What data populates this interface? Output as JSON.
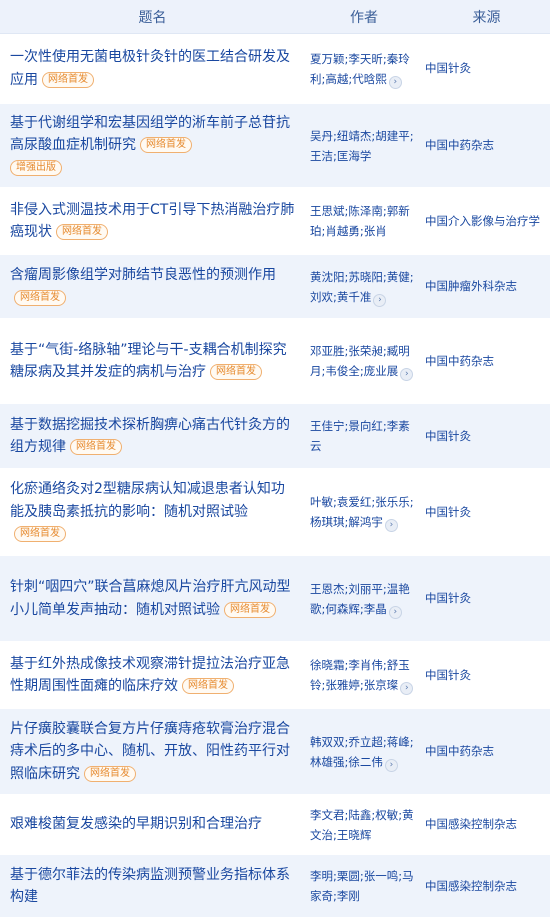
{
  "header": {
    "title": "题名",
    "author": "作者",
    "source": "来源"
  },
  "more_glyph": "›",
  "rows": [
    {
      "title": "一次性使用无菌电极针灸针的医工结合研发及应用",
      "tags": [
        "网络首发"
      ],
      "authors": "夏万颖;李天昕;秦玲利;高越;代晗熙",
      "more": true,
      "source": "中国针灸"
    },
    {
      "title": "基于代谢组学和宏基因组学的淅车前子总苷抗高尿酸血症机制研究",
      "tags": [
        "网络首发",
        "增强出版"
      ],
      "authors": "吴丹;纽靖杰;胡建平;王洁;匡海学",
      "more": false,
      "source": "中国中药杂志"
    },
    {
      "title": "非侵入式测温技术用于CT引导下热消融治疗肺癌现状",
      "tags": [
        "网络首发"
      ],
      "authors": "王思斌;陈泽南;郭新珀;肖越勇;张肖",
      "more": false,
      "source": "中国介入影像与治疗学"
    },
    {
      "title": "含瘤周影像组学对肺结节良恶性的预测作用",
      "tags": [
        "网络首发"
      ],
      "authors": "黄沈阳;苏晓阳;黄健;刘欢;黄千准",
      "more": true,
      "source": "中国肿瘤外科杂志"
    },
    {
      "title": "基于“气街-络脉轴”理论与干-支耦合机制探究糖尿病及其并发症的病机与治疗",
      "tags": [
        "网络首发"
      ],
      "authors": "邓亚胜;张荣昶;臧明月;韦俊全;庞业展",
      "more": true,
      "source": "中国中药杂志"
    },
    {
      "title": "基于数据挖掘技术探析胸痹心痛古代针灸方的组方规律",
      "tags": [
        "网络首发"
      ],
      "authors": "王佳宁;景向红;李素云",
      "more": false,
      "source": "中国针灸"
    },
    {
      "title": "化瘀通络灸对2型糖尿病认知减退患者认知功能及胰岛素抵抗的影响：随机对照试验",
      "tags": [
        "网络首发"
      ],
      "authors": "叶敏;袁爱红;张乐乐;杨琪琪;解鸿宇",
      "more": true,
      "source": "中国针灸"
    },
    {
      "title": "针刺“咽四穴”联合菖麻熄风片治疗肝亢风动型小儿简单发声抽动：随机对照试验",
      "tags": [
        "网络首发"
      ],
      "authors": "王恩杰;刘丽平;温艳歌;何森辉;李晶",
      "more": true,
      "source": "中国针灸"
    },
    {
      "title": "基于红外热成像技术观察滞针提拉法治疗亚急性期周围性面瘫的临床疗效",
      "tags": [
        "网络首发"
      ],
      "authors": "徐晓霜;李肖伟;舒玉铃;张雅婷;张京璨",
      "more": true,
      "source": "中国针灸"
    },
    {
      "title": "片仔癀胶囊联合复方片仔癀痔疮软膏治疗混合痔术后的多中心、随机、开放、阳性药平行对照临床研究",
      "tags": [
        "网络首发"
      ],
      "authors": "韩双双;乔立超;蒋峰;林雄强;徐二伟",
      "more": true,
      "source": "中国中药杂志"
    },
    {
      "title": "艰难梭菌复发感染的早期识别和合理治疗",
      "tags": [],
      "authors": "李文君;陆鑫;权敏;黄文治;王晓辉",
      "more": false,
      "source": "中国感染控制杂志"
    },
    {
      "title": "基于德尔菲法的传染病监测预警业务指标体系构建",
      "tags": [],
      "authors": "李明;栗圆;张一鸣;马家奇;李刚",
      "more": false,
      "source": "中国感染控制杂志"
    }
  ]
}
